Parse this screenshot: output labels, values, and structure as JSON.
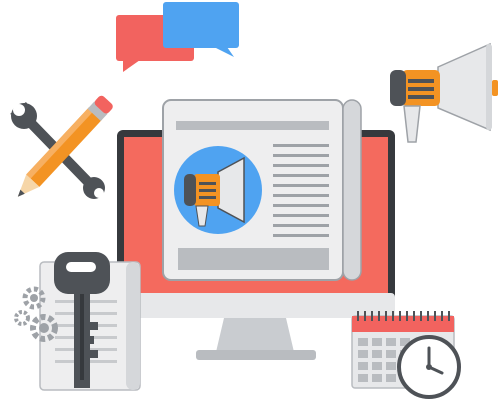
{
  "illustration": {
    "objects": [
      {
        "icon": "chat-bubbles-icon"
      },
      {
        "icon": "megaphone-icon"
      },
      {
        "icon": "wrench-icon"
      },
      {
        "icon": "pencil-icon"
      },
      {
        "icon": "monitor-icon"
      },
      {
        "icon": "newsletter-document-icon"
      },
      {
        "icon": "key-icon"
      },
      {
        "icon": "gear-icon"
      },
      {
        "icon": "calendar-icon"
      },
      {
        "icon": "clock-icon"
      }
    ],
    "palette": {
      "red": "#F2635F",
      "blue": "#4FA3F1",
      "orange": "#F39323",
      "dark": "#4E5257",
      "light_gray": "#E7E8EA",
      "mid_gray": "#B9BCC0",
      "screen_red": "#F46A5E",
      "line_gray": "#C8CACD"
    }
  }
}
